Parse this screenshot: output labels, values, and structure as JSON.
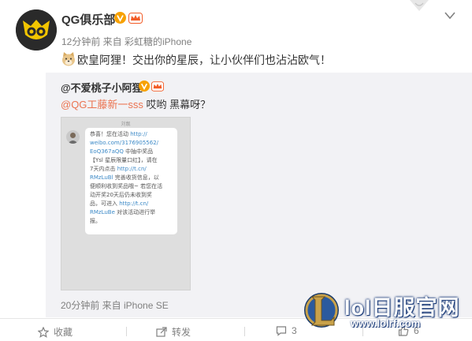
{
  "post": {
    "author": "QG俱乐部",
    "meta": "12分钟前 来自 彩虹糖的iPhone",
    "text": "欧皇阿狸！交出你的星辰，让小伙伴们也沾沾欧气！"
  },
  "repost": {
    "author": "@不爱桃子小阿狸",
    "mention": "@QG工藤新一sss",
    "text": " 哎哟 黑幕呀？",
    "meta": "20分钟前 来自 iPhone SE",
    "screenshot": {
      "title": "刘靓",
      "message_lines": [
        {
          "text": "恭喜！您在活动 ",
          "link": "http://"
        },
        {
          "text": "",
          "link": "weibo.com/3176905562/"
        },
        {
          "text": " 中抽中奖品",
          "link": "EoQ367aQQ",
          "link_first": true
        },
        {
          "text": "【Ysl 星辰限量口红】，请在",
          "link": ""
        },
        {
          "text": "7天内点击 ",
          "link": "http://t.cn/"
        },
        {
          "text": " 完善收货信息，以",
          "link": "RMzLuBl",
          "link_first": true
        },
        {
          "text": "便顺利收到奖品哦~ 若您在活",
          "link": ""
        },
        {
          "text": "动开奖20天后仍未收到奖",
          "link": ""
        },
        {
          "text": "品，可进入 ",
          "link": "http://t.cn/"
        },
        {
          "text": " 对该活动进行举",
          "link": "RMzLuBe",
          "link_first": true
        },
        {
          "text": "报。",
          "link": ""
        }
      ]
    }
  },
  "actions": {
    "favorite": "收藏",
    "forward": "转发",
    "comment": "3",
    "like": "6"
  },
  "watermark": {
    "title": "lol日服官网",
    "url": "www.lolrf.com"
  },
  "colors": {
    "mention": "#eb7350",
    "link": "#3d8ac7",
    "repost_bg": "#f2f2f5",
    "verified": "#f7a100"
  }
}
